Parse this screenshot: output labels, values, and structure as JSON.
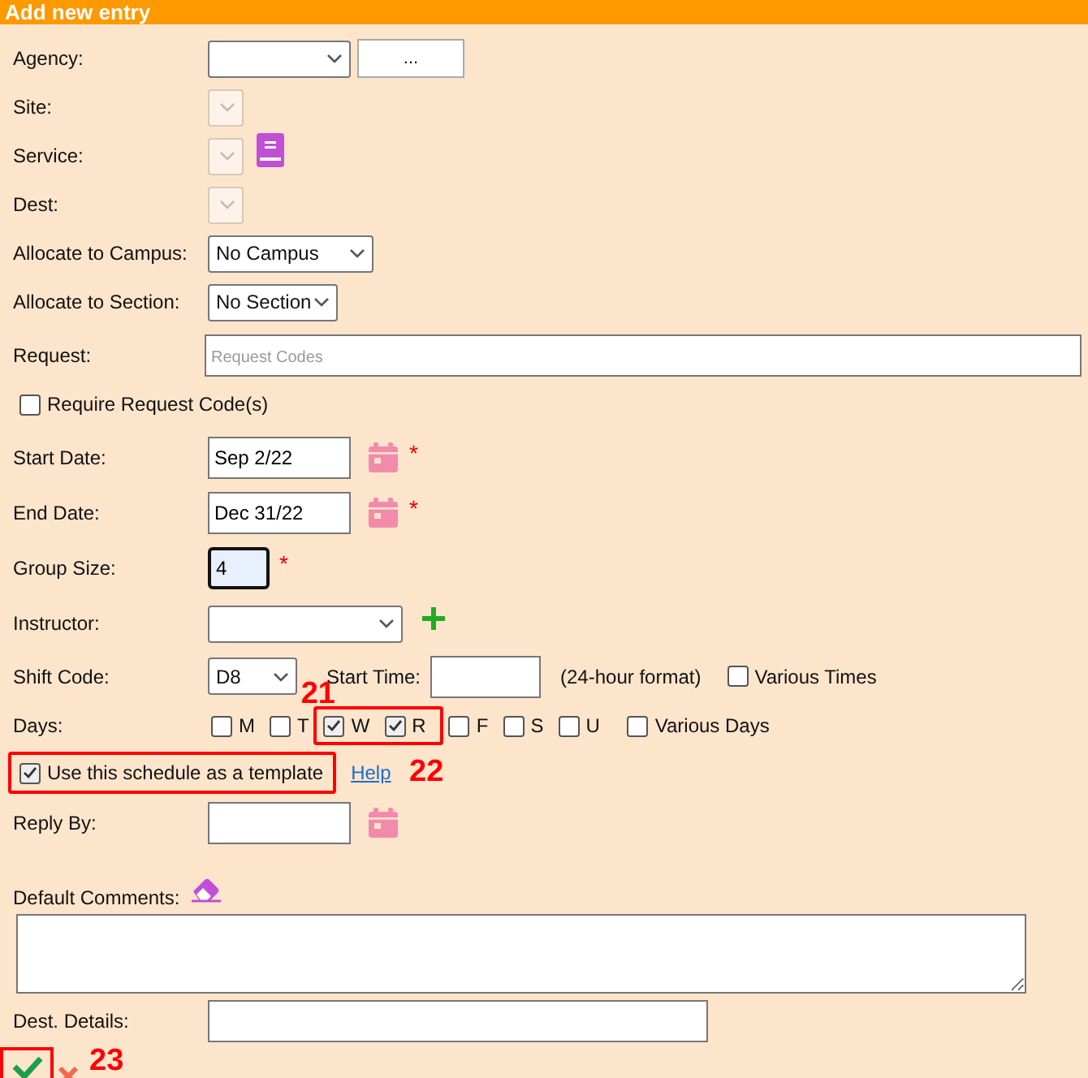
{
  "header": {
    "title": "Add new entry"
  },
  "rows": [
    {
      "kind": "select-browse",
      "label": "Agency:",
      "disabled": false,
      "button": "..."
    },
    {
      "kind": "select",
      "label": "Site:",
      "disabled": true
    },
    {
      "kind": "select-book",
      "label": "Service:",
      "disabled": true
    },
    {
      "kind": "select",
      "label": "Dest:",
      "disabled": true
    },
    {
      "kind": "select",
      "label": "Allocate to Campus:",
      "disabled": false,
      "value": "No Campus"
    },
    {
      "kind": "select",
      "label": "Allocate to Section:",
      "disabled": false,
      "value": "No Section"
    },
    {
      "kind": "wide-text",
      "label": "Request:",
      "placeholder": "Request Codes"
    },
    {
      "kind": "checkbox",
      "label": "Require Request Code(s)",
      "checked": false
    },
    {
      "kind": "date",
      "label": "Start Date:",
      "value": "Sep 2/22",
      "required_mark": "*"
    },
    {
      "kind": "date",
      "label": "End Date:",
      "value": "Dec 31/22",
      "required_mark": "*"
    },
    {
      "kind": "number",
      "label": "Group Size:",
      "value": "4",
      "required_mark": "*",
      "focused": true
    },
    {
      "kind": "select-add",
      "label": "Instructor:",
      "disabled": false
    },
    {
      "kind": "shift",
      "label": "Shift Code:",
      "value": "D8",
      "start_label": "Start Time:",
      "note": "(24-hour format)",
      "various": {
        "label": "Various Times",
        "checked": false
      }
    },
    {
      "kind": "days",
      "label": "Days:",
      "callout": "21",
      "groups": [
        {
          "highlighted": false,
          "days": [
            {
              "label": "M",
              "checked": false
            },
            {
              "label": "T",
              "checked": false
            }
          ]
        },
        {
          "highlighted": true,
          "days": [
            {
              "label": "W",
              "checked": true
            },
            {
              "label": "R",
              "checked": true
            }
          ]
        },
        {
          "highlighted": false,
          "days": [
            {
              "label": "F",
              "checked": false
            },
            {
              "label": "S",
              "checked": false
            },
            {
              "label": "U",
              "checked": false
            }
          ]
        }
      ],
      "various": {
        "label": "Various Days",
        "checked": false
      }
    },
    {
      "kind": "template",
      "label": "Use this schedule as a template",
      "checked": true,
      "highlighted": true,
      "link": "Help",
      "callout": "22"
    },
    {
      "kind": "date",
      "label": "Reply By:"
    },
    {
      "kind": "comments",
      "label": "Default Comments:"
    },
    {
      "kind": "text",
      "label": "Dest. Details:"
    }
  ],
  "actions": {
    "ok_highlighted": true,
    "callout": "23"
  }
}
